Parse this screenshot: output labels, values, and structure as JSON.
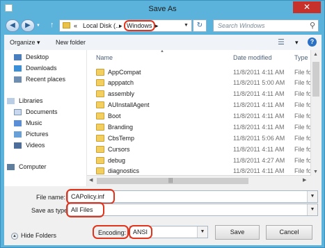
{
  "window": {
    "title": "Save As",
    "close_glyph": "✕"
  },
  "nav": {
    "back_glyph": "◀",
    "forward_glyph": "▶",
    "up_glyph": "↑"
  },
  "address": {
    "crumb_arrows": "«",
    "crumbs": [
      "Local Disk (...",
      "Windows"
    ],
    "separator": "▸",
    "refresh_glyph": "↻",
    "drop_glyph": "▼"
  },
  "search": {
    "placeholder": "Search Windows",
    "icon": "search-icon"
  },
  "toolbar": {
    "organize": "Organize ▾",
    "new_folder": "New folder",
    "view_glyph": "☰",
    "view_drop": "▾",
    "help_glyph": "?"
  },
  "sidebar": {
    "favorites": [
      {
        "label": "Desktop",
        "icon": "desktop-icon",
        "color": "#4a7fbf"
      },
      {
        "label": "Downloads",
        "icon": "downloads-icon",
        "color": "#3b8fd6"
      },
      {
        "label": "Recent places",
        "icon": "recent-places-icon",
        "color": "#6d8db1"
      }
    ],
    "libraries_label": "Libraries",
    "libraries": [
      {
        "label": "Documents",
        "icon": "documents-icon",
        "color": "#c9d8ec"
      },
      {
        "label": "Music",
        "icon": "music-icon",
        "color": "#5a8fd8"
      },
      {
        "label": "Pictures",
        "icon": "pictures-icon",
        "color": "#6aa0d8"
      },
      {
        "label": "Videos",
        "icon": "videos-icon",
        "color": "#4d6e9b"
      }
    ],
    "computer_label": "Computer"
  },
  "columns": {
    "name": "Name",
    "date": "Date modified",
    "type": "Type"
  },
  "files": [
    {
      "name": "AppCompat",
      "date": "11/8/2011 4:11 AM",
      "type": "File fol"
    },
    {
      "name": "apppatch",
      "date": "11/8/2011 5:00 AM",
      "type": "File fol"
    },
    {
      "name": "assembly",
      "date": "11/8/2011 4:11 AM",
      "type": "File fol"
    },
    {
      "name": "AUInstallAgent",
      "date": "11/8/2011 4:11 AM",
      "type": "File fol"
    },
    {
      "name": "Boot",
      "date": "11/8/2011 4:11 AM",
      "type": "File fol"
    },
    {
      "name": "Branding",
      "date": "11/8/2011 4:11 AM",
      "type": "File fol"
    },
    {
      "name": "CbsTemp",
      "date": "11/8/2011 5:06 AM",
      "type": "File fol"
    },
    {
      "name": "Cursors",
      "date": "11/8/2011 4:11 AM",
      "type": "File fol"
    },
    {
      "name": "debug",
      "date": "11/8/2011 4:27 AM",
      "type": "File fol"
    },
    {
      "name": "diagnostics",
      "date": "11/8/2011 4:11 AM",
      "type": "File fol"
    }
  ],
  "form": {
    "filename_label": "File name:",
    "filename_value": "CAPolicy.inf",
    "savetype_label": "Save as type:",
    "savetype_value": "All Files",
    "encoding_label": "Encoding:",
    "encoding_value": "ANSI"
  },
  "buttons": {
    "hide_folders": "Hide Folders",
    "save": "Save",
    "cancel": "Cancel"
  },
  "colors": {
    "highlight": "#e0341c",
    "chrome": "#5bb3dc",
    "close": "#c7312b"
  }
}
